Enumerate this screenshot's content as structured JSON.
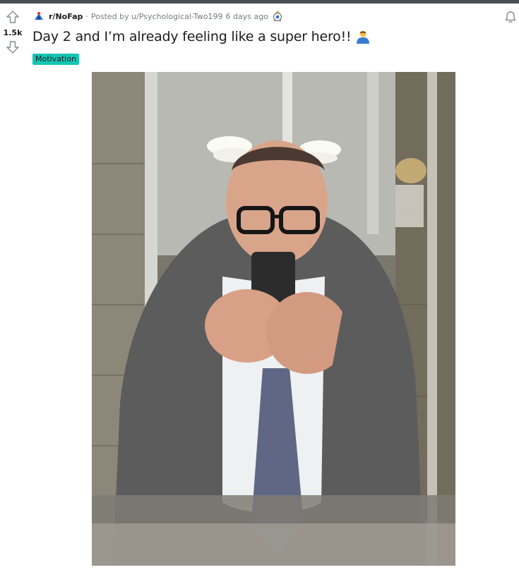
{
  "post": {
    "subreddit": "r/NoFap",
    "posted_by_prefix": "Posted by",
    "author": "u/Psychological-Two199",
    "time_ago": "6 days ago",
    "score": "1.5k",
    "title": "Day 2 and I’m already feeling like a super hero!!",
    "flair": "Motivation",
    "separator": "·"
  },
  "colors": {
    "flair_bg": "#14c6b4",
    "top_bar": "#4a4f55",
    "meta_text": "#787c7e"
  },
  "icons": {
    "upvote": "arrow-up-icon",
    "downvote": "arrow-down-icon",
    "subreddit": "subreddit-avatar-icon",
    "award": "award-icon",
    "notification": "bell-icon",
    "title_emoji": "person-emoji-icon"
  }
}
